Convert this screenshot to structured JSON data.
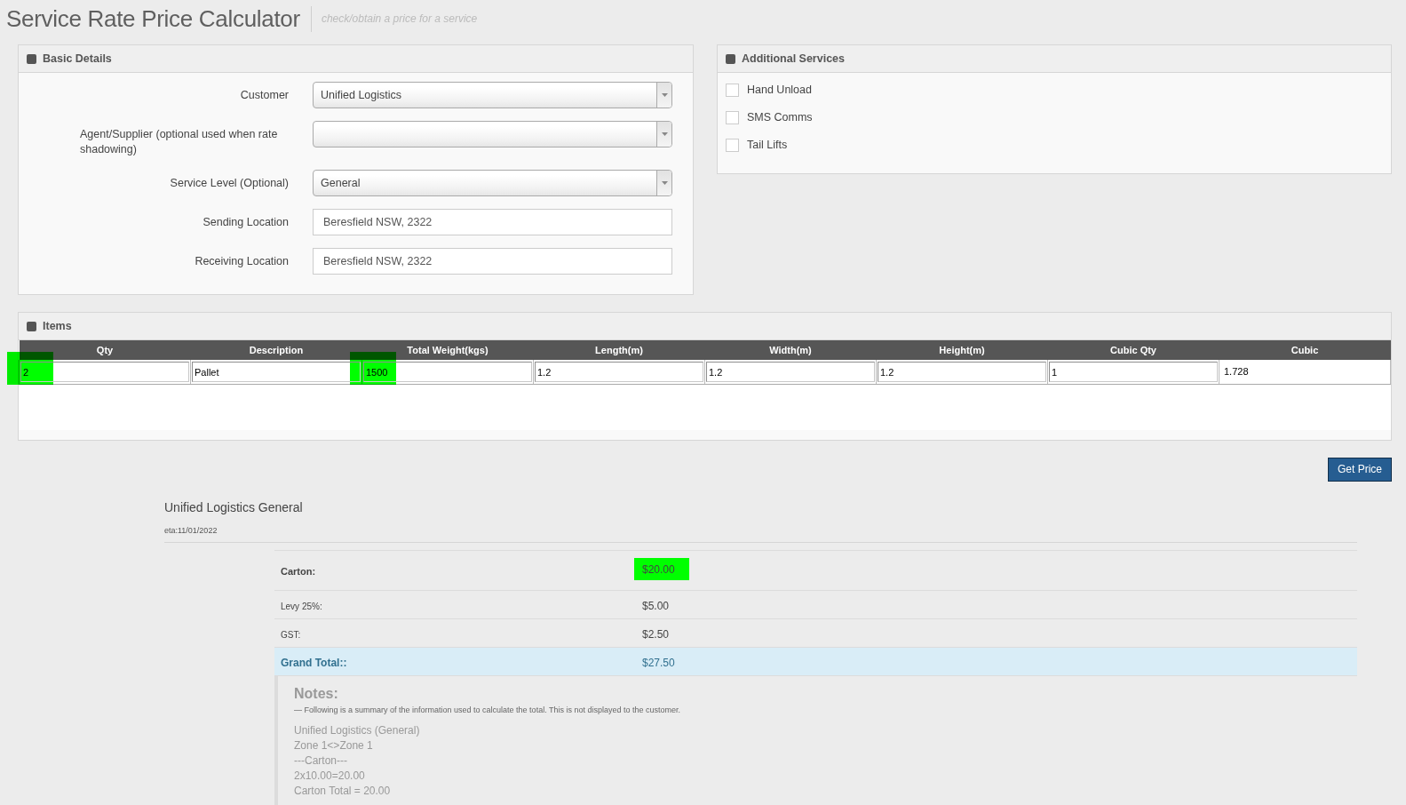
{
  "header": {
    "title": "Service Rate Price Calculator",
    "subtitle": "check/obtain a price for a service"
  },
  "basic_details": {
    "title": "Basic Details",
    "fields": [
      {
        "kind": "select",
        "label": "Customer",
        "value": "Unified Logistics"
      },
      {
        "kind": "select",
        "label": "Agent/Supplier (optional used when rate shadowing)"
      },
      {
        "kind": "select",
        "label": "Service Level (Optional)",
        "value": "General"
      },
      {
        "kind": "text",
        "label": "Sending Location",
        "value": "Beresfield NSW, 2322"
      },
      {
        "kind": "text",
        "label": "Receiving Location",
        "value": "Beresfield NSW, 2322"
      }
    ]
  },
  "additional_services": {
    "title": "Additional Services",
    "options": [
      {
        "label": "Hand Unload",
        "checked": false
      },
      {
        "label": "SMS Comms",
        "checked": false
      },
      {
        "label": "Tail Lifts",
        "checked": false
      }
    ]
  },
  "items": {
    "title": "Items",
    "columns": [
      "Qty",
      "Description",
      "Total Weight(kgs)",
      "Length(m)",
      "Width(m)",
      "Height(m)",
      "Cubic Qty",
      "Cubic"
    ],
    "rows": [
      {
        "cells": [
          {
            "kind": "input",
            "value": "2",
            "highlighted": true
          },
          {
            "kind": "input",
            "value": "Pallet",
            "highlighted": false
          },
          {
            "kind": "input",
            "value": "1500",
            "highlighted": true
          },
          {
            "kind": "input",
            "value": "1.2",
            "highlighted": false
          },
          {
            "kind": "input",
            "value": "1.2",
            "highlighted": false
          },
          {
            "kind": "input",
            "value": "1.2",
            "highlighted": false
          },
          {
            "kind": "input",
            "value": "1",
            "highlighted": false
          },
          {
            "kind": "text",
            "value": "1.728",
            "highlighted": false
          }
        ]
      }
    ]
  },
  "get_price_button": {
    "label": "Get Price"
  },
  "result": {
    "title": "Unified Logistics General",
    "eta": "eta:11/01/2022",
    "charges": [
      {
        "kind": "charge",
        "label": "Carton:",
        "amount": "$20.00",
        "highlighted": true
      },
      {
        "kind": "minor",
        "label": "Levy 25%:",
        "amount": "$5.00",
        "highlighted": false
      },
      {
        "kind": "minor",
        "label": "GST:",
        "amount": "$2.50",
        "highlighted": false
      },
      {
        "kind": "total",
        "label": "Grand Total::",
        "amount": "$27.50",
        "highlighted": false
      }
    ],
    "notes": {
      "title": "Notes:",
      "caption": "— Following is a summary of the information used to calculate the total. This is not displayed to the customer.",
      "lines": [
        "Unified Logistics (General)",
        "Zone 1<>Zone 1",
        "---Carton---",
        "2x10.00=20.00",
        "Carton Total = 20.00"
      ]
    }
  }
}
